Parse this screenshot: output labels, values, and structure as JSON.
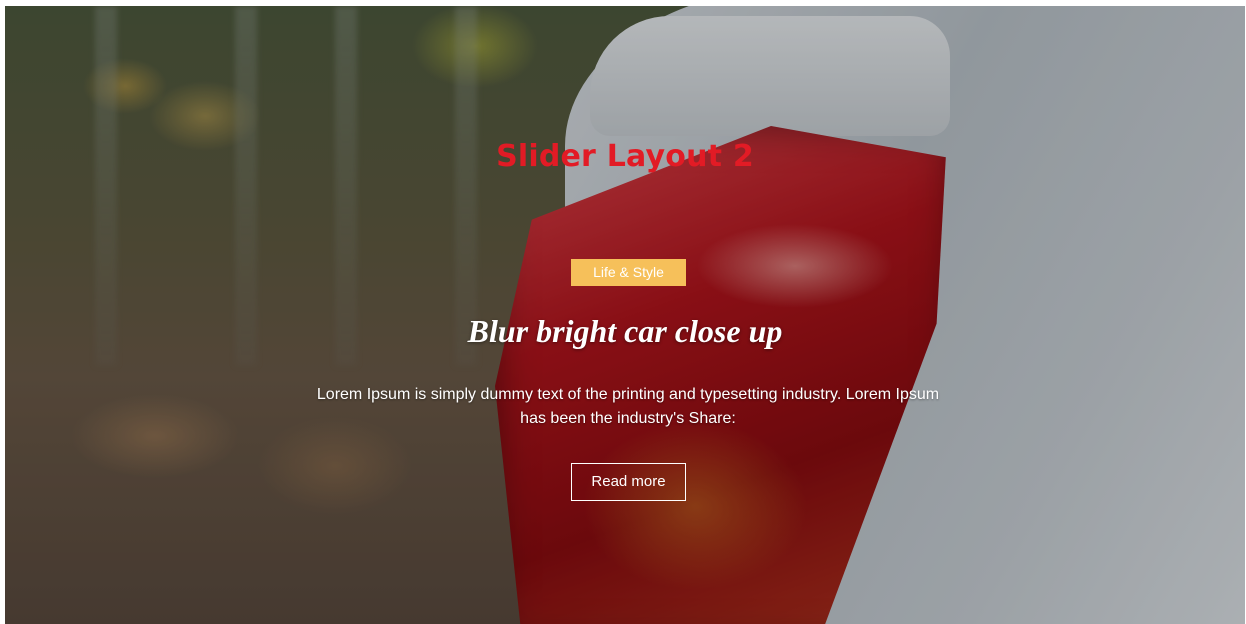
{
  "slider": {
    "layout_title": "Slider Layout 2",
    "slide": {
      "category": "Life & Style",
      "title": "Blur bright car close up",
      "excerpt": "Lorem Ipsum is simply dummy text of the printing and typesetting industry. Lorem Ipsum has been the industry's Share:",
      "read_more_label": "Read more"
    }
  },
  "colors": {
    "layout_title": "#e21b25",
    "category_badge": "#f6c05a",
    "text": "#ffffff"
  }
}
